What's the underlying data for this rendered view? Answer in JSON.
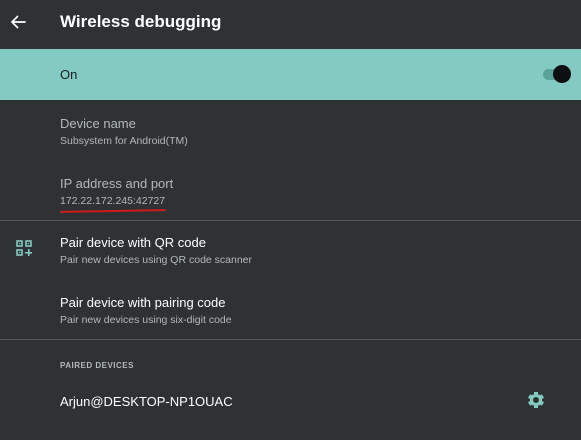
{
  "app_bar": {
    "title": "Wireless debugging",
    "back_icon": "arrow-back-icon"
  },
  "master_switch": {
    "label": "On",
    "state": "on",
    "accent": "#82cac2"
  },
  "device_name": {
    "title": "Device name",
    "value": "Subsystem for Android(TM)"
  },
  "ip_address": {
    "title": "IP address and port",
    "value": "172.22.172.245:42727",
    "annotation_color": "#d11a1a"
  },
  "pair_qr": {
    "title": "Pair device with QR code",
    "summary": "Pair new devices using QR code scanner",
    "icon": "qr-code-scanner-icon"
  },
  "pair_code": {
    "title": "Pair device with pairing code",
    "summary": "Pair new devices using six-digit code"
  },
  "paired_devices": {
    "header": "PAIRED DEVICES",
    "items": [
      {
        "name": "Arjun@DESKTOP-NP1OUAC",
        "icon": "gear-icon"
      }
    ]
  }
}
